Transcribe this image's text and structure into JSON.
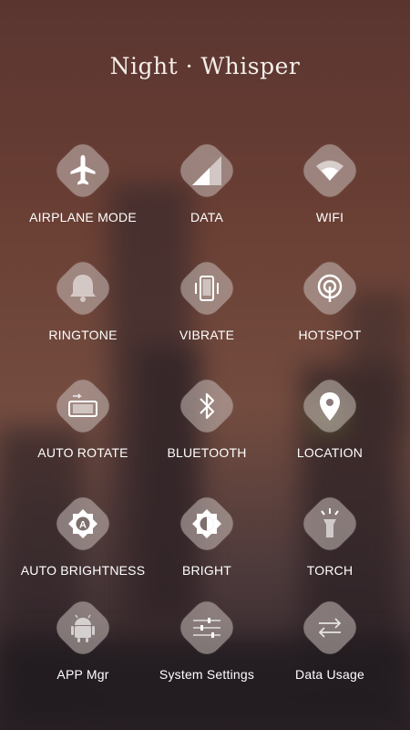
{
  "header": {
    "title": "Night · Whisper"
  },
  "tiles": [
    {
      "label": "AIRPLANE MODE"
    },
    {
      "label": "DATA"
    },
    {
      "label": "WIFI"
    },
    {
      "label": "RINGTONE"
    },
    {
      "label": "VIBRATE"
    },
    {
      "label": "HOTSPOT"
    },
    {
      "label": "AUTO ROTATE"
    },
    {
      "label": "BLUETOOTH"
    },
    {
      "label": "LOCATION"
    },
    {
      "label": "AUTO BRIGHTNESS"
    },
    {
      "label": "BRIGHT"
    },
    {
      "label": "TORCH"
    },
    {
      "label": "APP Mgr"
    },
    {
      "label": "System Settings"
    },
    {
      "label": "Data Usage"
    }
  ],
  "icons": {
    "auto_brightness_letter": "A"
  }
}
